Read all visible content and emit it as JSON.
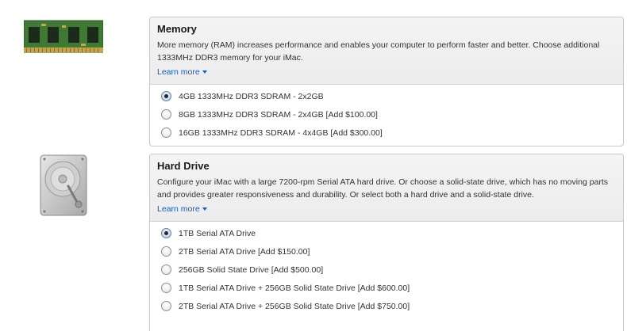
{
  "memory": {
    "title": "Memory",
    "description": "More memory (RAM) increases performance and enables your computer to perform faster and better. Choose additional 1333MHz DDR3 memory for your iMac.",
    "learn_more": "Learn more",
    "options": [
      {
        "label": "4GB 1333MHz DDR3 SDRAM - 2x2GB",
        "selected": true
      },
      {
        "label": "8GB 1333MHz DDR3 SDRAM - 2x4GB [Add $100.00]",
        "selected": false
      },
      {
        "label": "16GB 1333MHz DDR3 SDRAM - 4x4GB [Add $300.00]",
        "selected": false
      }
    ]
  },
  "hard_drive": {
    "title": "Hard Drive",
    "description": "Configure your iMac with a large 7200-rpm Serial ATA hard drive. Or choose a solid-state drive, which has no moving parts and provides greater responsiveness and durability. Or select both a hard drive and a solid-state drive.",
    "learn_more": "Learn more",
    "options": [
      {
        "label": "1TB Serial ATA Drive",
        "selected": true
      },
      {
        "label": "2TB Serial ATA Drive [Add $150.00]",
        "selected": false
      },
      {
        "label": "256GB Solid State Drive [Add $500.00]",
        "selected": false
      },
      {
        "label": "1TB Serial ATA Drive + 256GB Solid State Drive [Add $600.00]",
        "selected": false
      },
      {
        "label": "2TB Serial ATA Drive + 256GB Solid State Drive [Add $750.00]",
        "selected": false
      }
    ]
  },
  "icons": {
    "ram": "ram-module-icon",
    "hdd": "hard-drive-icon",
    "caret": "caret-down-icon"
  },
  "colors": {
    "link": "#1060c8",
    "pcb_green": "#2f6a2a",
    "panel_border": "#c8c8c8"
  }
}
